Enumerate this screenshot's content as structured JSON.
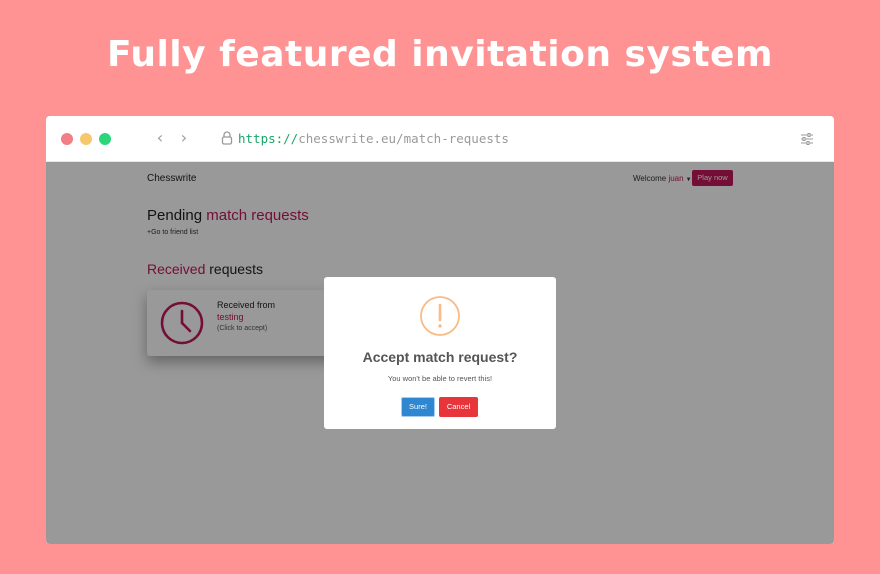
{
  "headline": "Fully featured invitation system",
  "browser": {
    "url_scheme": "https://",
    "url_rest": "chesswrite.eu/match-requests",
    "icons": [
      "back-arrow-icon",
      "forward-arrow-icon",
      "lock-icon",
      "settings-sliders-icon"
    ]
  },
  "site": {
    "brand": "Chesswrite",
    "welcome_label": "Welcome",
    "username": "juan",
    "play_button": "Play now",
    "pending_title_plain": "Pending",
    "pending_title_accent": "match requests",
    "friend_link": "+Go to friend list",
    "received_title_accent": "Received",
    "received_title_plain": "requests",
    "request_card": {
      "from_label": "Received from",
      "from_user": "testing",
      "hint": "(Click to accept)",
      "icon": "clock-icon"
    }
  },
  "modal": {
    "icon": "warning-icon",
    "title": "Accept match request?",
    "text": "You won't be able to revert this!",
    "confirm_label": "Sure!",
    "cancel_label": "Cancel"
  },
  "colors": {
    "background": "#ff9393",
    "accent": "#c2185b",
    "confirm": "#2f86d1",
    "cancel": "#e8353b",
    "warning": "#f8bb86"
  }
}
